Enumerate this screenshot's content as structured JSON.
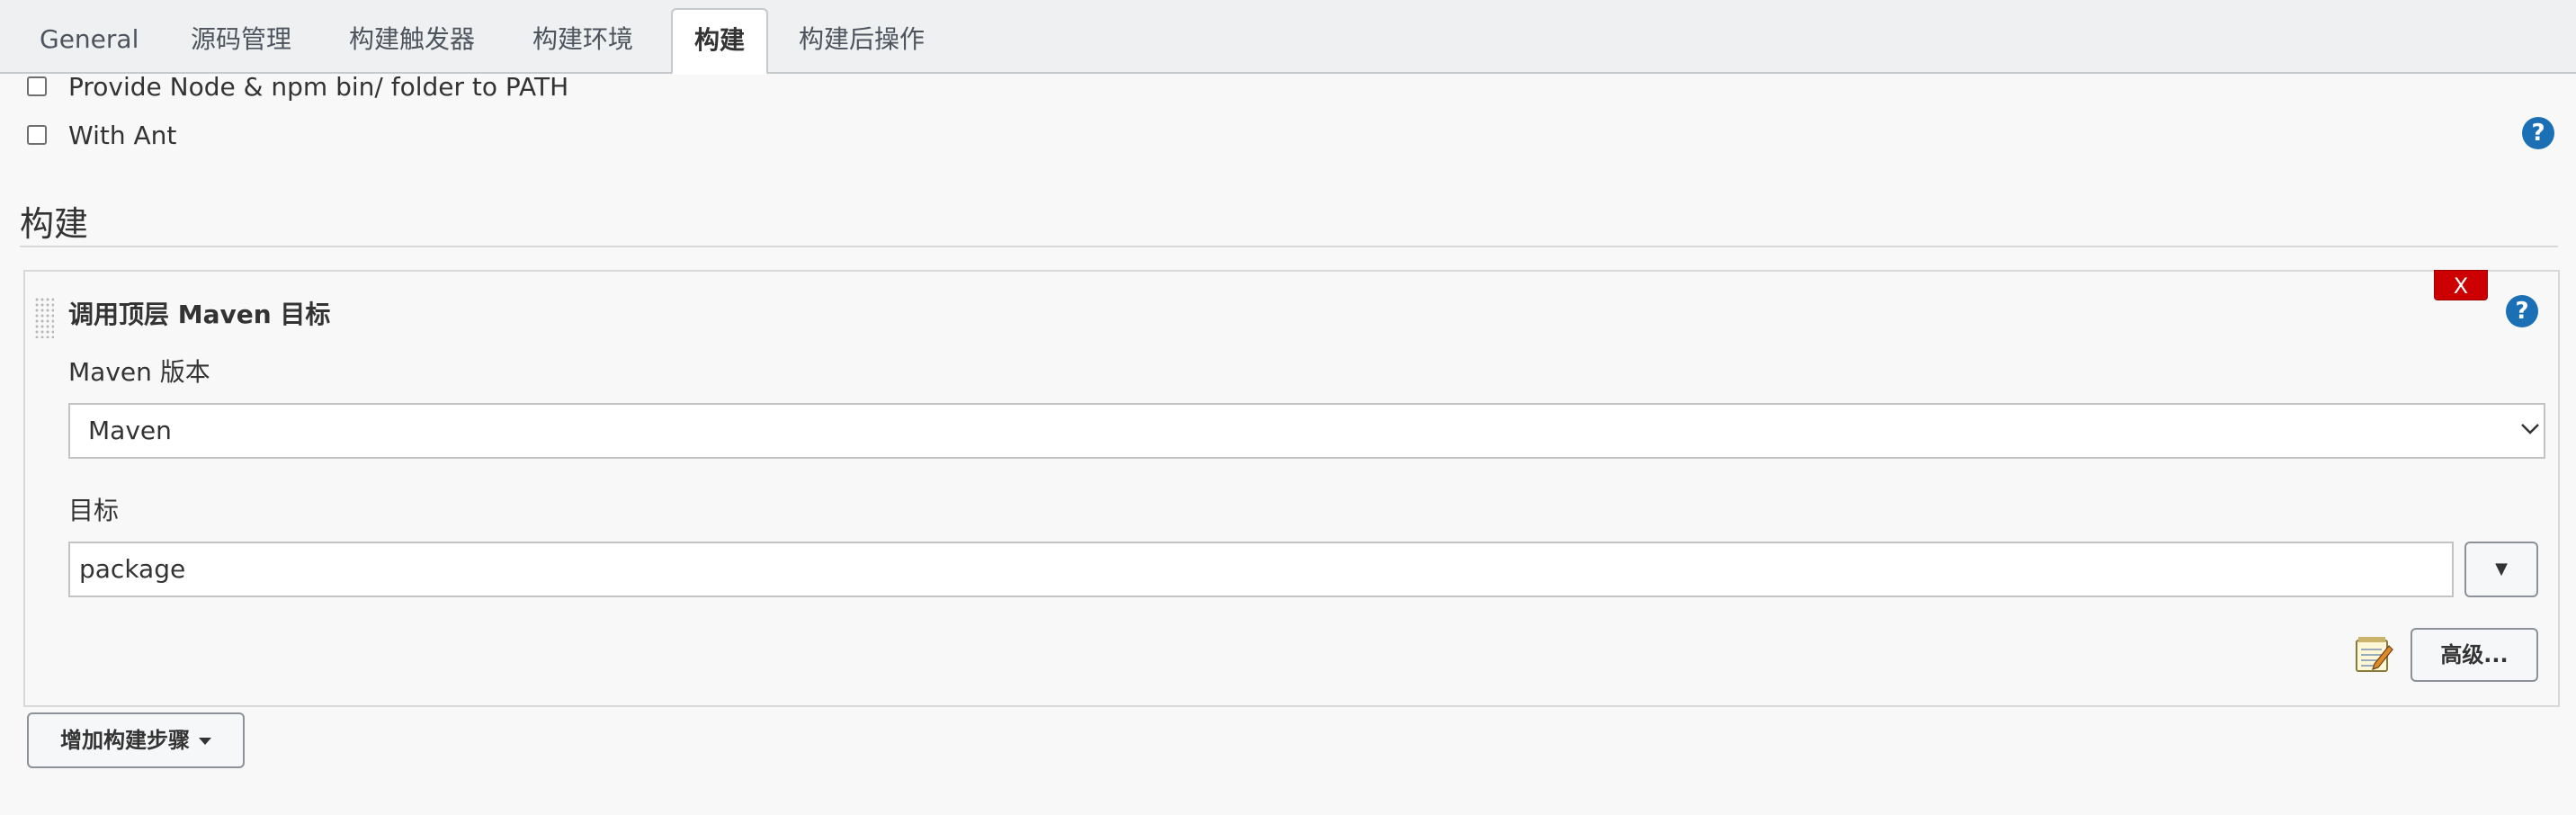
{
  "tabs": [
    {
      "label": "General",
      "active": false
    },
    {
      "label": "源码管理",
      "active": false
    },
    {
      "label": "构建触发器",
      "active": false
    },
    {
      "label": "构建环境",
      "active": false
    },
    {
      "label": "构建",
      "active": true
    },
    {
      "label": "构建后操作",
      "active": false
    }
  ],
  "build_env": {
    "options": [
      {
        "label": "Provide Node & npm bin/ folder to PATH",
        "checked": false
      },
      {
        "label": "With Ant",
        "checked": false
      }
    ],
    "help_icon": "question-mark"
  },
  "build": {
    "section_title": "构建",
    "step": {
      "title": "调用顶层 Maven 目标",
      "delete_label": "X",
      "help_icon": "question-mark",
      "maven_version": {
        "label": "Maven 版本",
        "selected": "Maven"
      },
      "goals": {
        "label": "目标",
        "value": "package",
        "dropdown_glyph": "▼"
      },
      "notepad_icon": "notepad-pencil",
      "advanced_label": "高级..."
    },
    "add_step_label": "增加构建步骤"
  },
  "colors": {
    "help_blue": "#1a6fb5",
    "delete_red": "#cc0000",
    "tabbar_bg": "#eff0f1",
    "page_bg": "#f8f8f8"
  }
}
